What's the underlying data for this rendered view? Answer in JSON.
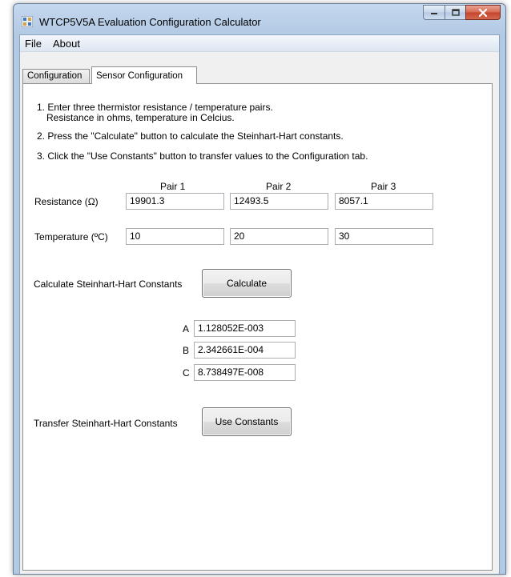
{
  "window": {
    "title": "WTCP5V5A Evaluation Configuration Calculator"
  },
  "menu": {
    "file": "File",
    "about": "About"
  },
  "tabs": {
    "configuration": "Configuration",
    "sensor_configuration": "Sensor Configuration"
  },
  "instructions": {
    "step1_line1": "1.  Enter three thermistor resistance / temperature pairs.",
    "step1_line2": "Resistance in ohms, temperature in Celcius.",
    "step2": "2.  Press the \"Calculate\" button to calculate the Steinhart-Hart constants.",
    "step3": "3.  Click the \"Use Constants\" button to transfer values to the Configuration tab."
  },
  "pairs": {
    "headers": [
      "Pair 1",
      "Pair 2",
      "Pair 3"
    ],
    "resistance_label": "Resistance (Ω)",
    "temperature_label": "Temperature (ºC)",
    "resistance": [
      "19901.3",
      "12493.5",
      "8057.1"
    ],
    "temperature": [
      "10",
      "20",
      "30"
    ]
  },
  "calculate": {
    "label": "Calculate Steinhart-Hart Constants",
    "button": "Calculate"
  },
  "constants": {
    "a_label": "A",
    "b_label": "B",
    "c_label": "C",
    "a": "1.128052E-003",
    "b": "2.342661E-004",
    "c": "8.738497E-008"
  },
  "transfer": {
    "label": "Transfer Steinhart-Hart Constants",
    "button": "Use Constants"
  },
  "colors": {
    "titlebar": "#b2c9e4",
    "client": "#f0f0f0",
    "close_button": "#c5422b"
  }
}
